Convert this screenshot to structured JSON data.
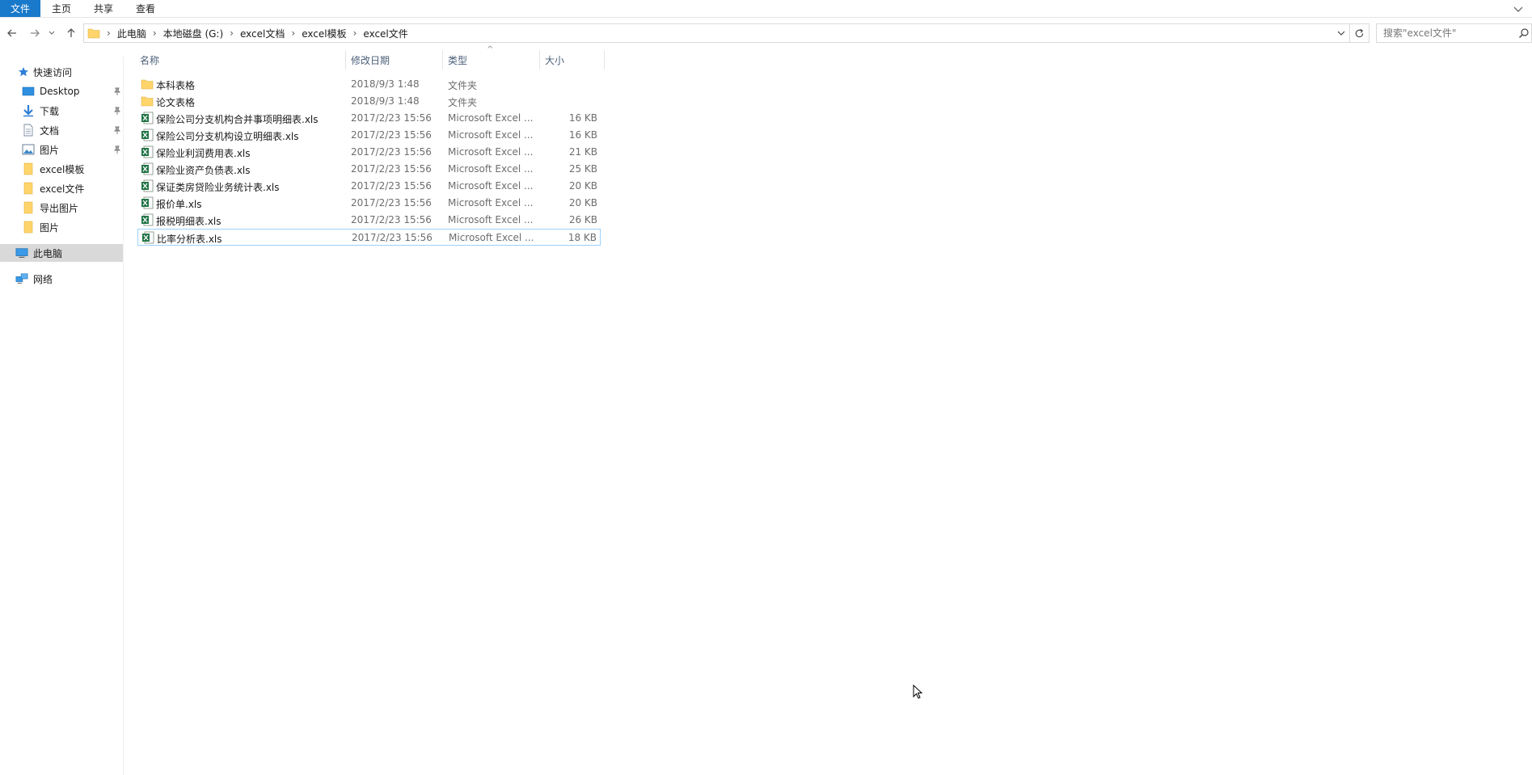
{
  "ribbon": {
    "tabs": [
      "文件",
      "主页",
      "共享",
      "查看"
    ]
  },
  "address": {
    "crumbs": [
      "此电脑",
      "本地磁盘 (G:)",
      "excel文档",
      "excel模板",
      "excel文件"
    ]
  },
  "search": {
    "placeholder": "搜索\"excel文件\""
  },
  "nav": {
    "quick_access": "快速访问",
    "items": [
      {
        "label": "Desktop",
        "icon": "desktop-icon",
        "pinned": true
      },
      {
        "label": "下载",
        "icon": "download-icon",
        "pinned": true
      },
      {
        "label": "文档",
        "icon": "documents-icon",
        "pinned": true
      },
      {
        "label": "图片",
        "icon": "pictures-icon",
        "pinned": true
      },
      {
        "label": "excel模板",
        "icon": "folder-icon",
        "pinned": false
      },
      {
        "label": "excel文件",
        "icon": "folder-icon",
        "pinned": false
      },
      {
        "label": "导出图片",
        "icon": "folder-icon",
        "pinned": false
      },
      {
        "label": "图片",
        "icon": "folder-icon",
        "pinned": false
      }
    ],
    "this_pc": "此电脑",
    "network": "网络"
  },
  "columns": {
    "name": "名称",
    "date": "修改日期",
    "type": "类型",
    "size": "大小"
  },
  "files": [
    {
      "name": "本科表格",
      "date": "2018/9/3 1:48",
      "type": "文件夹",
      "size": "",
      "kind": "folder"
    },
    {
      "name": "论文表格",
      "date": "2018/9/3 1:48",
      "type": "文件夹",
      "size": "",
      "kind": "folder"
    },
    {
      "name": "保险公司分支机构合并事项明细表.xls",
      "date": "2017/2/23 15:56",
      "type": "Microsoft Excel ...",
      "size": "16 KB",
      "kind": "excel"
    },
    {
      "name": "保险公司分支机构设立明细表.xls",
      "date": "2017/2/23 15:56",
      "type": "Microsoft Excel ...",
      "size": "16 KB",
      "kind": "excel"
    },
    {
      "name": "保险业利润费用表.xls",
      "date": "2017/2/23 15:56",
      "type": "Microsoft Excel ...",
      "size": "21 KB",
      "kind": "excel"
    },
    {
      "name": "保险业资产负债表.xls",
      "date": "2017/2/23 15:56",
      "type": "Microsoft Excel ...",
      "size": "25 KB",
      "kind": "excel"
    },
    {
      "name": "保证类房贷险业务统计表.xls",
      "date": "2017/2/23 15:56",
      "type": "Microsoft Excel ...",
      "size": "20 KB",
      "kind": "excel"
    },
    {
      "name": "报价单.xls",
      "date": "2017/2/23 15:56",
      "type": "Microsoft Excel ...",
      "size": "20 KB",
      "kind": "excel"
    },
    {
      "name": "报税明细表.xls",
      "date": "2017/2/23 15:56",
      "type": "Microsoft Excel ...",
      "size": "26 KB",
      "kind": "excel"
    },
    {
      "name": "比率分析表.xls",
      "date": "2017/2/23 15:56",
      "type": "Microsoft Excel ...",
      "size": "18 KB",
      "kind": "excel",
      "selected": true
    }
  ],
  "colors": {
    "accent": "#1979ca",
    "folder": "#ffd56b",
    "excel": "#217346",
    "selection_border": "#99d1ff"
  }
}
